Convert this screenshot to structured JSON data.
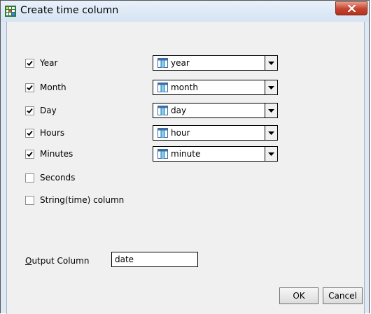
{
  "window": {
    "title": "Create time column"
  },
  "fields": [
    {
      "label": "Year",
      "checked": true,
      "column": "year"
    },
    {
      "label": "Month",
      "checked": true,
      "column": "month"
    },
    {
      "label": "Day",
      "checked": true,
      "column": "day"
    },
    {
      "label": "Hours",
      "checked": true,
      "column": "hour"
    },
    {
      "label": "Minutes",
      "checked": true,
      "column": "minute"
    },
    {
      "label": "Seconds",
      "checked": false
    },
    {
      "label": "String(time) column",
      "checked": false
    }
  ],
  "output": {
    "label_mnemonic": "O",
    "label_rest": "utput Column",
    "value": "date"
  },
  "buttons": {
    "ok": "OK",
    "cancel": "Cancel"
  },
  "colors": {
    "close_button": "#c4432e",
    "titlebar": "#dfe9f5",
    "client": "#f0f0f0"
  },
  "icons": {
    "app": "app-grid-icon",
    "column": "column-icon",
    "dropdown": "dropdown-arrow-icon",
    "close": "close-icon",
    "check": "checkmark-icon"
  }
}
